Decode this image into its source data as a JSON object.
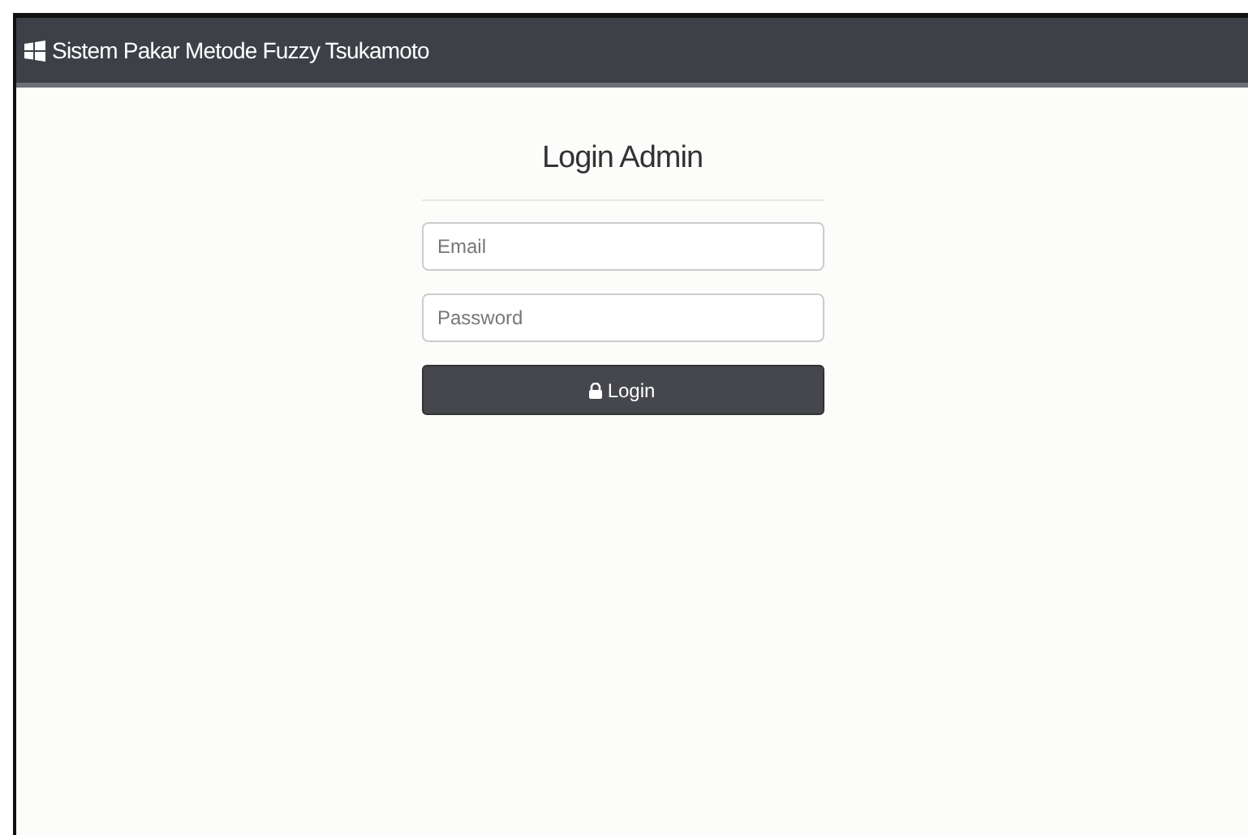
{
  "navbar": {
    "brand": "Sistem Pakar Metode Fuzzy Tsukamoto"
  },
  "login": {
    "title": "Login Admin",
    "fields": [
      {
        "placeholder": "Email"
      },
      {
        "placeholder": "Password"
      }
    ],
    "button": "Login"
  }
}
